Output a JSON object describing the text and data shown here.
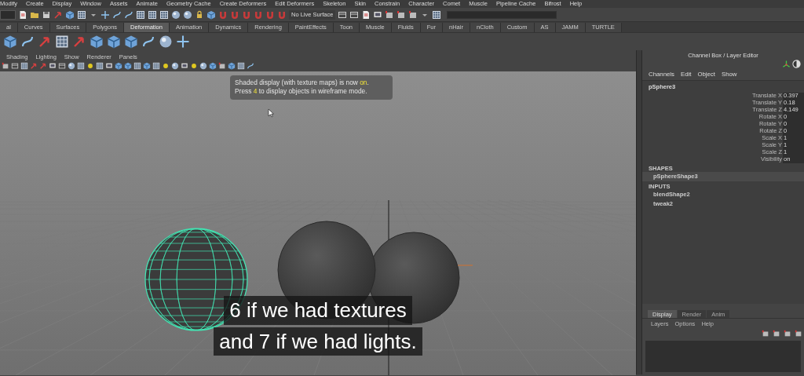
{
  "menu_bar": [
    "Modify",
    "Create",
    "Display",
    "Window",
    "Assets",
    "Animate",
    "Geometry Cache",
    "Create Deformers",
    "Edit Deformers",
    "Skeleton",
    "Skin",
    "Constrain",
    "Character",
    "Comet",
    "Muscle",
    "Pipeline Cache",
    "Bifrost",
    "Help"
  ],
  "status_line": {
    "live_surface": "No Live Surface"
  },
  "shelf_tabs": [
    {
      "label": "al",
      "selected": false
    },
    {
      "label": "Curves",
      "selected": false
    },
    {
      "label": "Surfaces",
      "selected": false
    },
    {
      "label": "Polygons",
      "selected": false
    },
    {
      "label": "Deformation",
      "selected": true
    },
    {
      "label": "Animation",
      "selected": false
    },
    {
      "label": "Dynamics",
      "selected": false
    },
    {
      "label": "Rendering",
      "selected": false
    },
    {
      "label": "PaintEffects",
      "selected": false
    },
    {
      "label": "Toon",
      "selected": false
    },
    {
      "label": "Muscle",
      "selected": false
    },
    {
      "label": "Fluids",
      "selected": false
    },
    {
      "label": "Fur",
      "selected": false
    },
    {
      "label": "nHair",
      "selected": false
    },
    {
      "label": "nCloth",
      "selected": false
    },
    {
      "label": "Custom",
      "selected": false
    },
    {
      "label": "AS",
      "selected": false
    },
    {
      "label": "JAMM",
      "selected": false
    },
    {
      "label": "TURTLE",
      "selected": false
    }
  ],
  "viewport": {
    "menu": [
      "Shading",
      "Lighting",
      "Show",
      "Renderer",
      "Panels"
    ],
    "tooltip": [
      "Shaded display (with texture maps) is now **on**.",
      "Press **4** to display objects in wireframe mode."
    ],
    "subtitles": [
      "6 if we had textures",
      "and 7 if we had lights."
    ]
  },
  "channel_box": {
    "title": "Channel Box / Layer Editor",
    "menu": [
      "Channels",
      "Edit",
      "Object",
      "Show"
    ],
    "object": "pSphere3",
    "attributes": [
      {
        "name": "Translate X",
        "value": "0.397"
      },
      {
        "name": "Translate Y",
        "value": "0.18"
      },
      {
        "name": "Translate Z",
        "value": "4.149"
      },
      {
        "name": "Rotate X",
        "value": "0"
      },
      {
        "name": "Rotate Y",
        "value": "0"
      },
      {
        "name": "Rotate Z",
        "value": "0"
      },
      {
        "name": "Scale X",
        "value": "1"
      },
      {
        "name": "Scale Y",
        "value": "1"
      },
      {
        "name": "Scale Z",
        "value": "1"
      },
      {
        "name": "Visibility",
        "value": "on"
      }
    ],
    "shapes_heading": "SHAPES",
    "shapes": [
      {
        "name": "pSphereShape3",
        "selected": true
      }
    ],
    "inputs_heading": "INPUTS",
    "inputs": [
      {
        "name": "blendShape2",
        "selected": false
      },
      {
        "name": "tweak2",
        "selected": false
      }
    ]
  },
  "layer_editor": {
    "tabs": [
      {
        "label": "Display",
        "selected": true
      },
      {
        "label": "Render",
        "selected": false
      },
      {
        "label": "Anim",
        "selected": false
      }
    ],
    "menu": [
      "Layers",
      "Options",
      "Help"
    ]
  }
}
